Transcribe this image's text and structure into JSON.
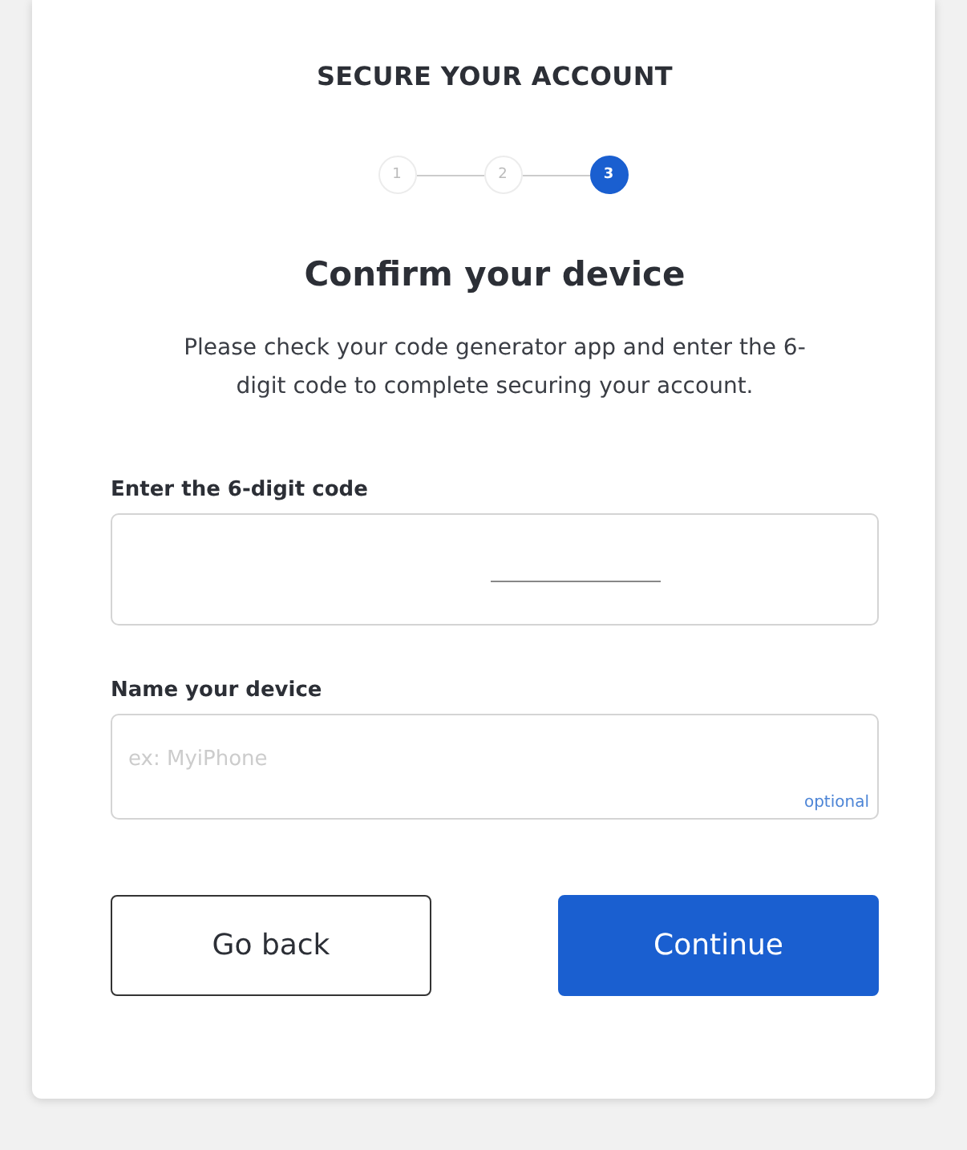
{
  "header": "SECURE YOUR ACCOUNT",
  "steps": [
    {
      "label": "1",
      "selected": false
    },
    {
      "label": "2",
      "selected": false
    },
    {
      "label": "3",
      "selected": true
    }
  ],
  "heading": "Confirm your device",
  "description": "Please check your code generator app and enter the 6-digit code to complete securing your account.",
  "code_field": {
    "label": "Enter the 6-digit code"
  },
  "device_field": {
    "label": "Name your device",
    "placeholder": "ex: MyiPhone",
    "hint": "optional"
  },
  "buttons": [
    {
      "label": "Go back",
      "kind": "secondary"
    },
    {
      "label": "Continue",
      "kind": "primary"
    }
  ]
}
